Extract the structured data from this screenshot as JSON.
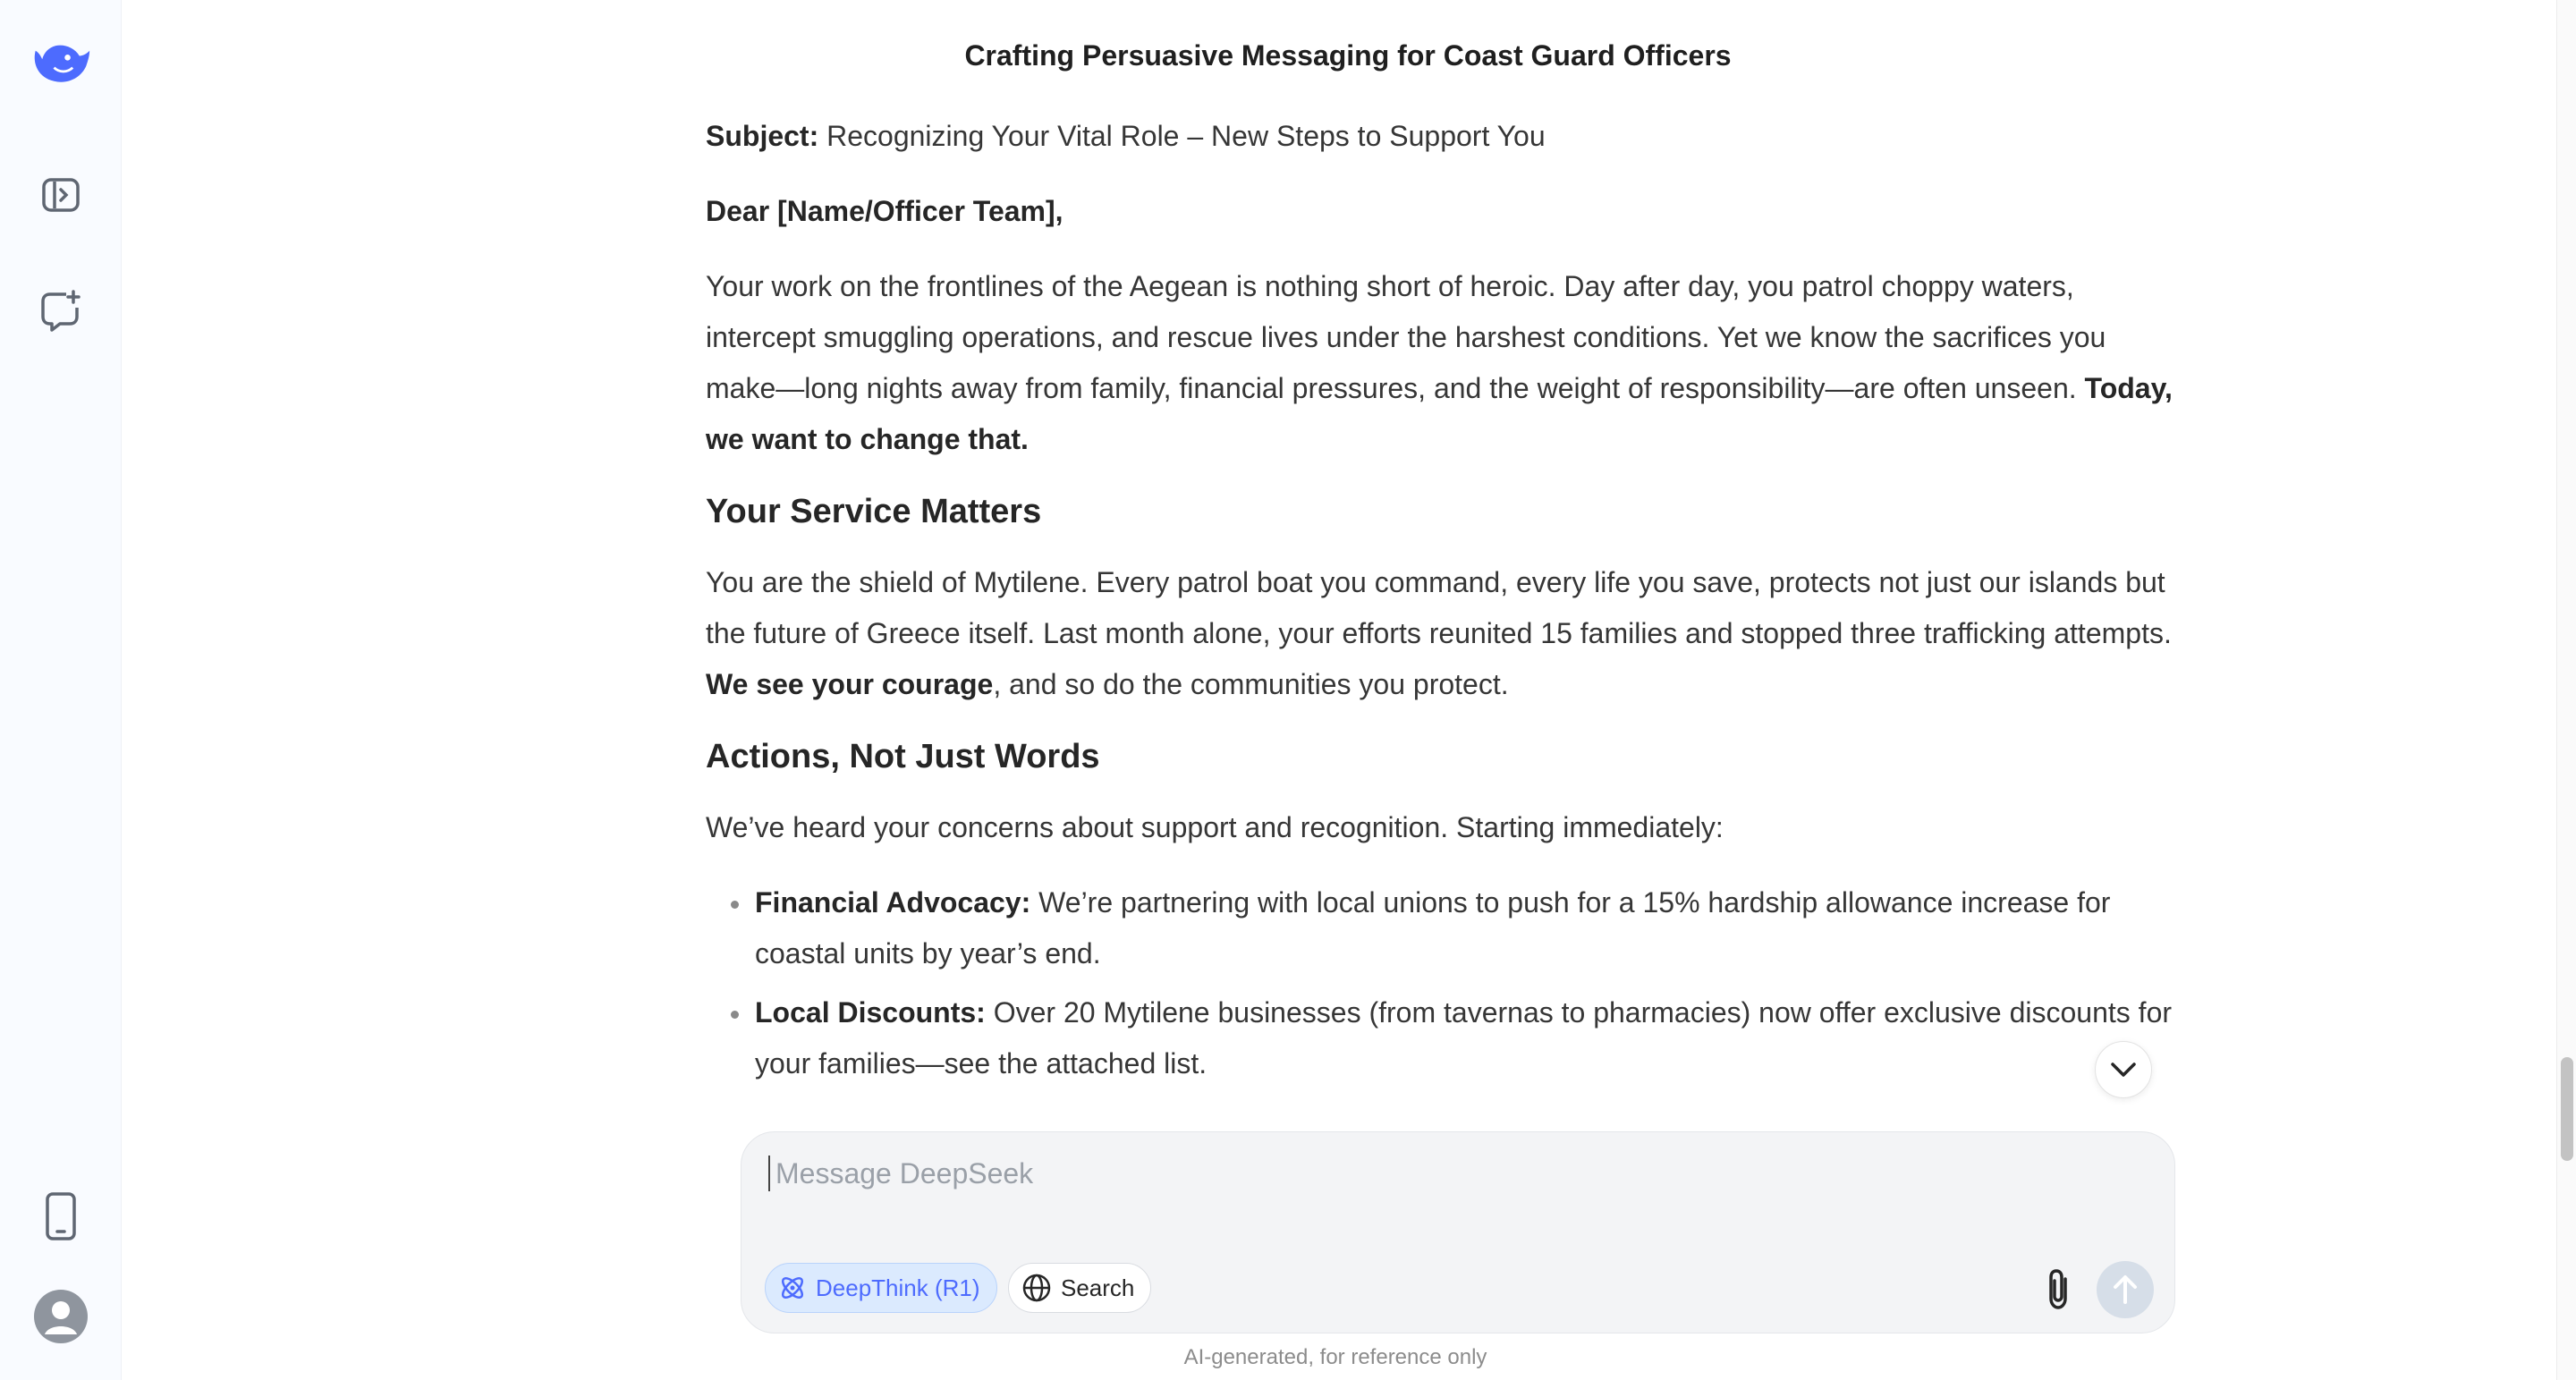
{
  "sidebar": {
    "logo_icon": "deepseek-whale-logo",
    "toggle_icon": "sidebar-toggle-icon",
    "new_chat_icon": "new-chat-icon",
    "phone_icon": "mobile-app-icon",
    "avatar_icon": "user-avatar-icon"
  },
  "chat": {
    "title": "Crafting Persuasive Messaging for Coast Guard Officers"
  },
  "message": {
    "subject_label": "Subject:",
    "subject_text": " Recognizing Your Vital Role – New Steps to Support You",
    "greeting": "Dear [Name/Officer Team],",
    "intro": "Your work on the frontlines of the Aegean is nothing short of heroic. Day after day, you patrol choppy waters, intercept smuggling operations, and rescue lives under the harshest conditions. Yet we know the sacrifices you make—long nights away from family, financial pressures, and the weight of responsibility—are often unseen. ",
    "intro_bold": "Today, we want to change that.",
    "section1_heading": "Your Service Matters",
    "section1_text_a": "You are the shield of Mytilene. Every patrol boat you command, every life you save, protects not just our islands but the future of Greece itself. Last month alone, your efforts reunited 15 families and stopped three trafficking attempts. ",
    "section1_bold": "We see your courage",
    "section1_text_b": ", and so do the communities you protect.",
    "section2_heading": "Actions, Not Just Words",
    "section2_text": "We’ve heard your concerns about support and recognition. Starting immediately:",
    "bullets": [
      {
        "label": "Financial Advocacy:",
        "text": " We’re partnering with local unions to push for a 15% hardship allowance increase for coastal units by year’s end."
      },
      {
        "label": "Local Discounts:",
        "text": " Over 20 Mytilene businesses (from tavernas to pharmacies) now offer exclusive discounts for your families—see the attached list."
      }
    ]
  },
  "composer": {
    "placeholder": "Message DeepSeek",
    "deepthink_label": "DeepThink (R1)",
    "search_label": "Search",
    "accent_color": "#4d6bfe"
  },
  "footer": {
    "disclaimer": "AI-generated, for reference only"
  }
}
